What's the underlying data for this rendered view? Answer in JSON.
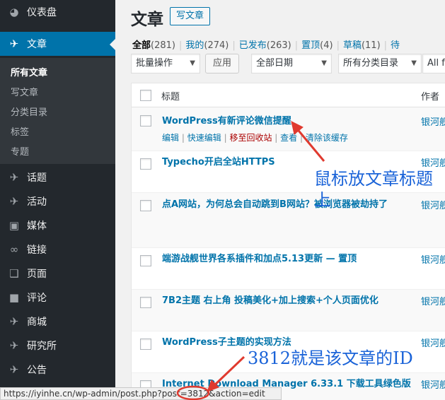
{
  "sidebar": {
    "items": [
      {
        "icon": "dashboard-icon",
        "glyph": "◕",
        "label": "仪表盘"
      },
      {
        "icon": "pushpin-icon",
        "glyph": "✈",
        "label": "文章"
      },
      {
        "icon": "pushpin-icon",
        "glyph": "✈",
        "label": "话题"
      },
      {
        "icon": "pushpin-icon",
        "glyph": "✈",
        "label": "活动"
      },
      {
        "icon": "media-icon",
        "glyph": "▣",
        "label": "媒体"
      },
      {
        "icon": "link-icon",
        "glyph": "∞",
        "label": "链接"
      },
      {
        "icon": "page-icon",
        "glyph": "❑",
        "label": "页面"
      },
      {
        "icon": "comment-icon",
        "glyph": "■",
        "label": "评论"
      },
      {
        "icon": "pushpin-icon",
        "glyph": "✈",
        "label": "商城"
      },
      {
        "icon": "pushpin-icon",
        "glyph": "✈",
        "label": "研究所"
      },
      {
        "icon": "pushpin-icon",
        "glyph": "✈",
        "label": "公告"
      }
    ],
    "submenu": [
      "所有文章",
      "写文章",
      "分类目录",
      "标签",
      "专题"
    ]
  },
  "page": {
    "title": "文章",
    "add_new": "写文章"
  },
  "filters": {
    "all": "全部",
    "all_count": "(281)",
    "mine": "我的",
    "mine_count": "(274)",
    "published": "已发布",
    "published_count": "(263)",
    "sticky": "置顶",
    "sticky_count": "(4)",
    "drafts": "草稿",
    "drafts_count": "(11)",
    "more": "待"
  },
  "actions": {
    "bulk": "批量操作",
    "apply": "应用",
    "dates": "全部日期",
    "categories": "所有分类目录",
    "more_filter": "All f"
  },
  "table": {
    "col_title": "标题",
    "col_author": "作者",
    "rows": [
      {
        "title": "WordPress有新评论微信提醒",
        "author": "银河舰"
      },
      {
        "title": "Typecho开启全站HTTPS",
        "author": "银河舰"
      },
      {
        "title": "点A网站，为何总会自动跳到B网站？被浏览器被劫持了",
        "author": "银河舰"
      },
      {
        "title": "端游战舰世界各系插件和加点5.13更新 — 置顶",
        "author": "银河舰"
      },
      {
        "title": "7B2主题 右上角 投稿美化+加上搜索+个人页面优化",
        "author": "银河舰"
      },
      {
        "title": "WordPress子主题的实现方法",
        "author": "银河舰"
      },
      {
        "title": "Internet Download Manager 6.33.1 下载工具绿色版",
        "author": "银河舰"
      }
    ],
    "row_actions": {
      "edit": "编辑",
      "quick_edit": "快速编辑",
      "trash": "移至回收站",
      "view": "查看",
      "purge": "清除该缓存"
    }
  },
  "statusbar": {
    "url": "https://iyinhe.cn/wp-admin/post.php?post=3812&action=edit"
  },
  "annotations": {
    "hover_note": "鼠标放文章标题上",
    "id_note": "3812就是该文章的ID",
    "color": "#e03a2f"
  }
}
